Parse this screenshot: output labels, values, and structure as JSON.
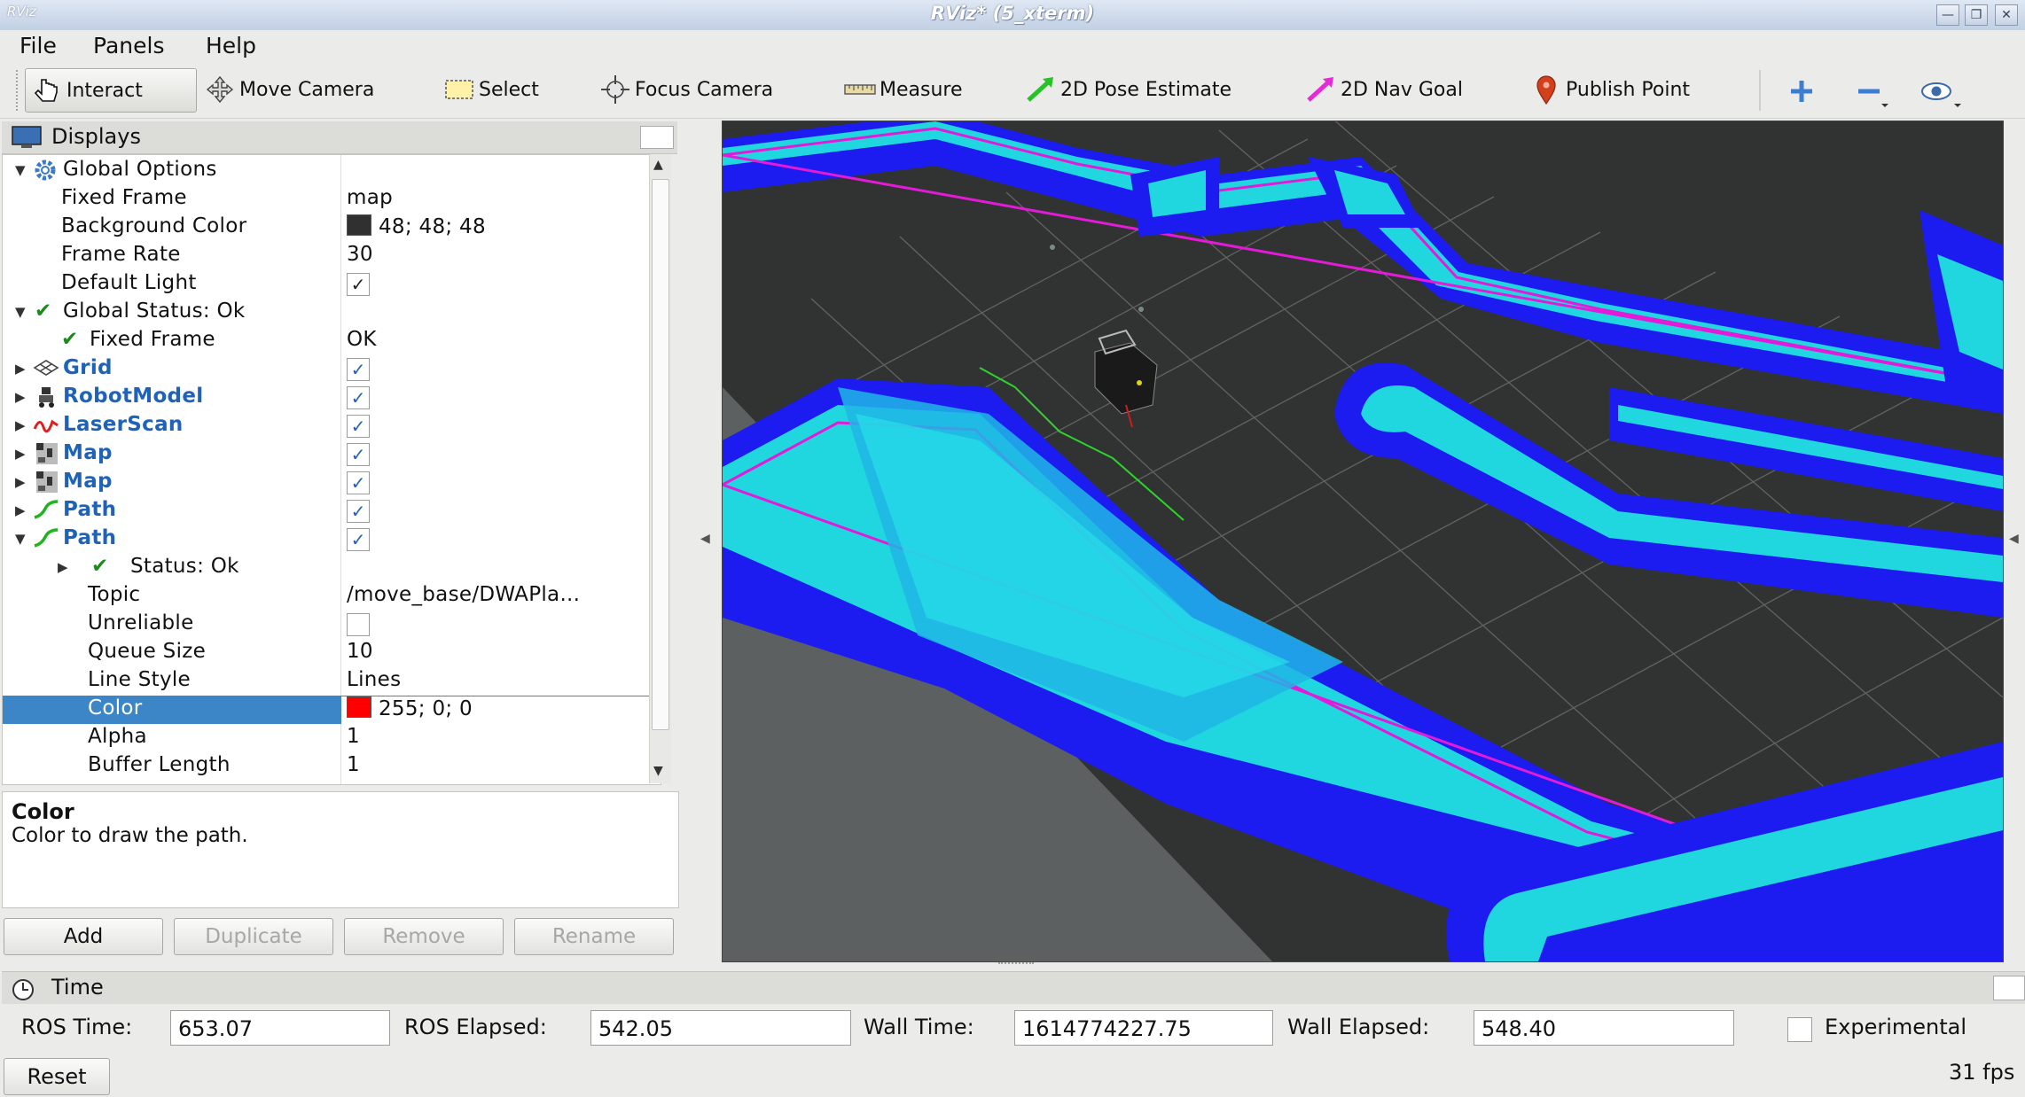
{
  "window": {
    "title": "RViz* (5_xterm)",
    "app_icon_text": "RViz"
  },
  "menu": [
    "File",
    "Panels",
    "Help"
  ],
  "toolbar": {
    "tools": [
      {
        "label": "Interact",
        "icon": "hand-pointer-icon",
        "active": true
      },
      {
        "label": "Move Camera",
        "icon": "move-camera-icon"
      },
      {
        "label": "Select",
        "icon": "select-box-icon"
      },
      {
        "label": "Focus Camera",
        "icon": "focus-crosshair-icon"
      },
      {
        "label": "Measure",
        "icon": "ruler-icon"
      },
      {
        "label": "2D Pose Estimate",
        "icon": "green-arrow-icon"
      },
      {
        "label": "2D Nav Goal",
        "icon": "magenta-arrow-icon"
      },
      {
        "label": "Publish Point",
        "icon": "map-pin-icon"
      }
    ],
    "extra_icons": [
      "plus-icon",
      "minus-icon",
      "eye-icon"
    ]
  },
  "displays": {
    "title": "Displays",
    "rows": [
      {
        "name": "Global Options",
        "value": ""
      },
      {
        "name": "Fixed Frame",
        "value": "map"
      },
      {
        "name": "Background Color",
        "value": "48; 48; 48",
        "swatch": "#303030"
      },
      {
        "name": "Frame Rate",
        "value": "30"
      },
      {
        "name": "Default Light",
        "checked": true
      },
      {
        "name": "Global Status: Ok",
        "value": ""
      },
      {
        "name": "Fixed Frame",
        "value": "OK"
      },
      {
        "name": "Grid",
        "checked": true
      },
      {
        "name": "RobotModel",
        "checked": true
      },
      {
        "name": "LaserScan",
        "checked": true
      },
      {
        "name": "Map",
        "checked": true
      },
      {
        "name": "Map",
        "checked": true
      },
      {
        "name": "Path",
        "checked": true
      },
      {
        "name": "Path",
        "checked": true
      },
      {
        "name": "Status: Ok",
        "value": ""
      },
      {
        "name": "Topic",
        "value": "/move_base/DWAPla..."
      },
      {
        "name": "Unreliable",
        "checked": false
      },
      {
        "name": "Queue Size",
        "value": "10"
      },
      {
        "name": "Line Style",
        "value": "Lines"
      },
      {
        "name": "Color",
        "value": "255; 0; 0",
        "swatch": "#ff0000",
        "selected": true
      },
      {
        "name": "Alpha",
        "value": "1"
      },
      {
        "name": "Buffer Length",
        "value": "1"
      }
    ]
  },
  "description": {
    "title": "Color",
    "text": "Color to draw the path."
  },
  "panel_buttons": [
    "Add",
    "Duplicate",
    "Remove",
    "Rename"
  ],
  "time": {
    "title": "Time",
    "ros_time_label": "ROS Time:",
    "ros_time": "653.07",
    "ros_elapsed_label": "ROS Elapsed:",
    "ros_elapsed": "542.05",
    "wall_time_label": "Wall Time:",
    "wall_time": "1614774227.75",
    "wall_elapsed_label": "Wall Elapsed:",
    "wall_elapsed": "548.40",
    "experimental_label": "Experimental",
    "reset_label": "Reset",
    "fps": "31 fps"
  },
  "colors": {
    "selection": "#3c86c8",
    "costmap_blue": "#1a1aff",
    "costmap_cyan": "#1fd8e0",
    "costmap_magenta": "#e01cd8",
    "path_green": "#2dd22d"
  }
}
